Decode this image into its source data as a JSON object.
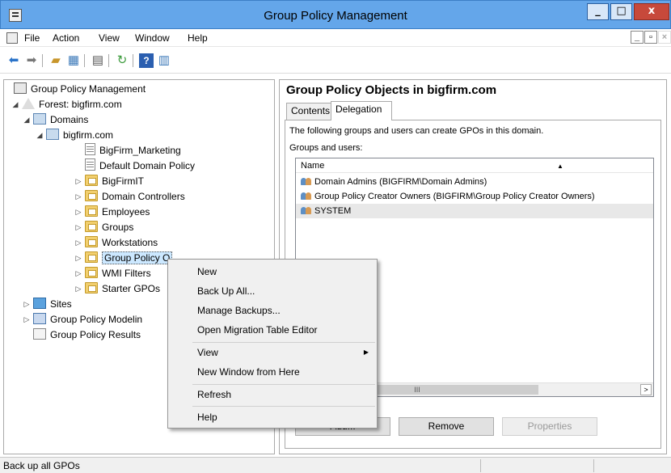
{
  "window": {
    "title": "Group Policy Management",
    "controls": {
      "minimize": "_",
      "maximize": "□",
      "close": "x"
    }
  },
  "menubar": {
    "items": [
      "File",
      "Action",
      "View",
      "Window",
      "Help"
    ],
    "mdi_controls": [
      "_",
      "▫",
      "×"
    ]
  },
  "toolbar": {
    "icons": [
      "back-icon",
      "forward-icon",
      "up-folder-icon",
      "show-hide-tree-icon",
      "properties-icon",
      "refresh-icon",
      "help-icon",
      "action-pane-icon"
    ]
  },
  "tree": {
    "items": [
      {
        "label": "Group Policy Management",
        "icon": "mgmt-icon",
        "toggle": ""
      },
      {
        "label": "Forest: bigfirm.com",
        "icon": "forest-icon",
        "toggle": "◢"
      },
      {
        "label": "Domains",
        "icon": "domains-icon",
        "toggle": "◢"
      },
      {
        "label": "bigfirm.com",
        "icon": "domain-icon",
        "toggle": "◢"
      },
      {
        "label": "BigFirm_Marketing",
        "icon": "gpo-link-icon",
        "toggle": ""
      },
      {
        "label": "Default Domain Policy",
        "icon": "gpo-link-icon",
        "toggle": ""
      },
      {
        "label": "BigFirmIT",
        "icon": "ou-icon",
        "toggle": "▷"
      },
      {
        "label": "Domain Controllers",
        "icon": "ou-icon",
        "toggle": "▷"
      },
      {
        "label": "Employees",
        "icon": "ou-icon",
        "toggle": "▷"
      },
      {
        "label": "Groups",
        "icon": "ou-icon",
        "toggle": "▷"
      },
      {
        "label": "Workstations",
        "icon": "ou-icon",
        "toggle": "▷"
      },
      {
        "label": "Group Policy O",
        "icon": "gpo-container-icon",
        "toggle": "▷"
      },
      {
        "label": "WMI Filters",
        "icon": "wmi-filter-icon",
        "toggle": "▷"
      },
      {
        "label": "Starter GPOs",
        "icon": "starter-gpo-icon",
        "toggle": "▷"
      },
      {
        "label": "Sites",
        "icon": "sites-icon",
        "toggle": "▷"
      },
      {
        "label": "Group Policy Modelin",
        "icon": "modeling-icon",
        "toggle": "▷"
      },
      {
        "label": "Group Policy Results",
        "icon": "results-icon",
        "toggle": ""
      }
    ]
  },
  "detail": {
    "title": "Group Policy Objects in bigfirm.com",
    "tabs": [
      "Contents",
      "Delegation"
    ],
    "active_tab": "Delegation",
    "description": "The following groups and users can create GPOs in this domain.",
    "groups_label": "Groups and users:",
    "column": "Name",
    "sort_indicator": "▲",
    "rows": [
      "Domain Admins (BIGFIRM\\Domain Admins)",
      "Group Policy Creator Owners (BIGFIRM\\Group Policy Creator Owners)",
      "SYSTEM"
    ],
    "scrollbar_thumb": "III",
    "scroll_right_arrow": ">",
    "buttons": {
      "add": "Add...",
      "remove": "Remove",
      "properties": "Properties"
    }
  },
  "context_menu": {
    "items": [
      {
        "label": "New"
      },
      {
        "label": "Back Up All..."
      },
      {
        "label": "Manage Backups..."
      },
      {
        "label": "Open Migration Table Editor"
      },
      {
        "label": "View",
        "submenu": "▶"
      },
      {
        "label": "New Window from Here"
      },
      {
        "label": "Refresh"
      },
      {
        "label": "Help"
      }
    ]
  },
  "statusbar": {
    "text": "Back up all GPOs"
  }
}
